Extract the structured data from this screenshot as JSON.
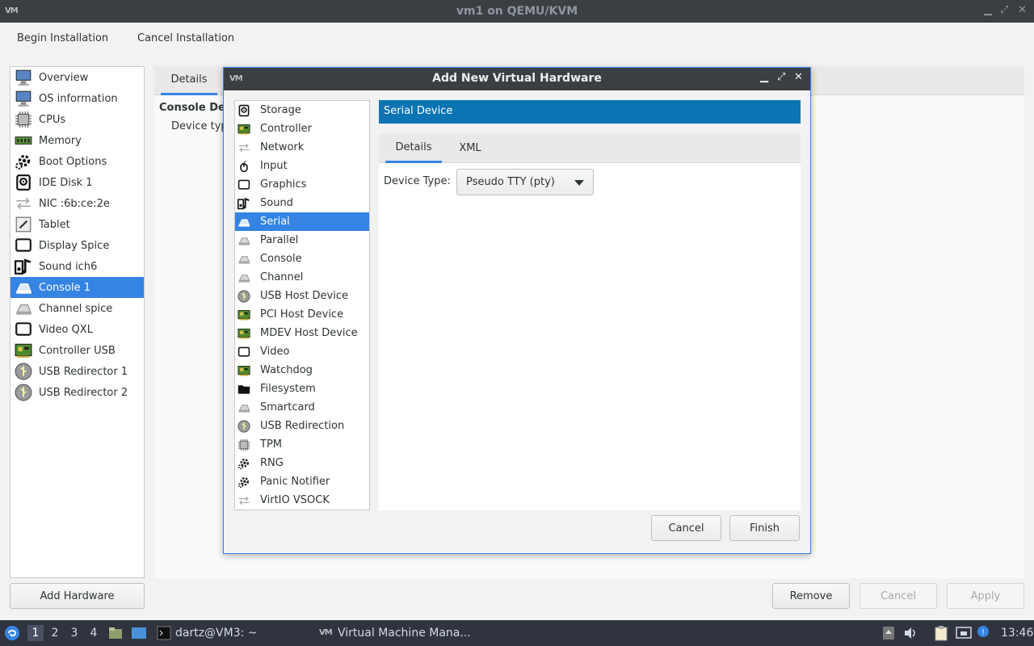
{
  "window": {
    "title": "vm1 on QEMU/KVM",
    "logo": "VM",
    "controls": {
      "minimize": "▁",
      "restore": "⤢",
      "close": "✕"
    }
  },
  "menubar": {
    "begin_installation": "Begin Installation",
    "cancel_installation": "Cancel Installation"
  },
  "hardware_list": {
    "items": [
      {
        "label": "Overview",
        "icon": "monitor-icon"
      },
      {
        "label": "OS information",
        "icon": "monitor-icon"
      },
      {
        "label": "CPUs",
        "icon": "cpu-icon"
      },
      {
        "label": "Memory",
        "icon": "memory-icon"
      },
      {
        "label": "Boot Options",
        "icon": "gear-icon"
      },
      {
        "label": "IDE Disk 1",
        "icon": "disk-icon"
      },
      {
        "label": "NIC :6b:ce:2e",
        "icon": "network-icon"
      },
      {
        "label": "Tablet",
        "icon": "tablet-icon"
      },
      {
        "label": "Display Spice",
        "icon": "display-icon"
      },
      {
        "label": "Sound ich6",
        "icon": "sound-icon"
      },
      {
        "label": "Console 1",
        "icon": "serial-icon",
        "selected": true
      },
      {
        "label": "Channel spice",
        "icon": "serial-icon"
      },
      {
        "label": "Video QXL",
        "icon": "display-icon"
      },
      {
        "label": "Controller USB",
        "icon": "card-icon"
      },
      {
        "label": "USB Redirector 1",
        "icon": "usb-icon"
      },
      {
        "label": "USB Redirector 2",
        "icon": "usb-icon"
      }
    ],
    "add_hardware_label": "Add Hardware"
  },
  "details_panel": {
    "tab_label": "Details",
    "heading": "Console De",
    "device_type_partial": "Device typ",
    "buttons": {
      "remove": "Remove",
      "cancel": "Cancel",
      "apply": "Apply"
    }
  },
  "dialog": {
    "title": "Add New Virtual Hardware",
    "logo": "VM",
    "controls": {
      "minimize": "▁",
      "restore": "⤢",
      "close": "✕"
    },
    "device_types": [
      {
        "label": "Storage",
        "icon": "disk-icon"
      },
      {
        "label": "Controller",
        "icon": "card-icon"
      },
      {
        "label": "Network",
        "icon": "network-icon"
      },
      {
        "label": "Input",
        "icon": "mouse-icon"
      },
      {
        "label": "Graphics",
        "icon": "display-icon"
      },
      {
        "label": "Sound",
        "icon": "sound-icon"
      },
      {
        "label": "Serial",
        "icon": "serial-icon",
        "selected": true
      },
      {
        "label": "Parallel",
        "icon": "serial-icon"
      },
      {
        "label": "Console",
        "icon": "serial-icon"
      },
      {
        "label": "Channel",
        "icon": "serial-icon"
      },
      {
        "label": "USB Host Device",
        "icon": "usb-icon"
      },
      {
        "label": "PCI Host Device",
        "icon": "card-icon"
      },
      {
        "label": "MDEV Host Device",
        "icon": "card-icon"
      },
      {
        "label": "Video",
        "icon": "display-icon"
      },
      {
        "label": "Watchdog",
        "icon": "card-icon"
      },
      {
        "label": "Filesystem",
        "icon": "folder-icon"
      },
      {
        "label": "Smartcard",
        "icon": "serial-icon"
      },
      {
        "label": "USB Redirection",
        "icon": "usb-icon"
      },
      {
        "label": "TPM",
        "icon": "cpu-icon"
      },
      {
        "label": "RNG",
        "icon": "gear-icon"
      },
      {
        "label": "Panic Notifier",
        "icon": "gear-icon"
      },
      {
        "label": "VirtIO VSOCK",
        "icon": "network-icon"
      }
    ],
    "header": "Serial Device",
    "tabs": {
      "details": "Details",
      "xml": "XML"
    },
    "device_type_label": "Device Type:",
    "device_type_value": "Pseudo TTY (pty)",
    "buttons": {
      "cancel": "Cancel",
      "finish": "Finish"
    }
  },
  "taskbar": {
    "workspaces": [
      "1",
      "2",
      "3",
      "4"
    ],
    "terminal_label": "dartz@VM3: ~",
    "app_label": "Virtual Machine Mana...",
    "app_logo": "VM",
    "clock": "13:46"
  }
}
